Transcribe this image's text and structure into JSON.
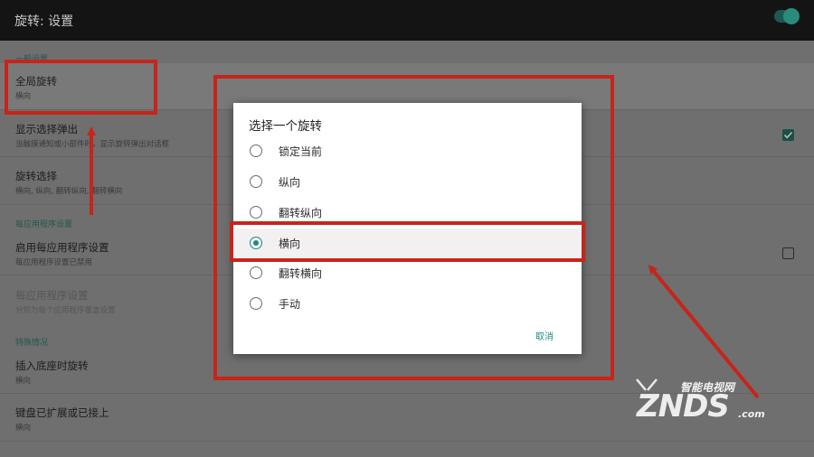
{
  "appbar": {
    "title": "旋转: 设置",
    "master_switch_on": true
  },
  "settings": {
    "general_header": "一般设置",
    "global_rotation": {
      "title": "全局旋转",
      "summary": "横向"
    },
    "show_popup": {
      "title": "显示选择弹出",
      "summary": "当触摸通知或小部件时，显示旋转弹出对话框",
      "checked": true
    },
    "rotation_selection": {
      "title": "旋转选择",
      "summary": "横向, 纵向, 翻转纵向, 翻转横向"
    },
    "per_app_header": "每应用程序设置",
    "enable_per_app": {
      "title": "启用每应用程序设置",
      "summary": "每应用程序设置已禁用",
      "checked": false
    },
    "per_app_settings": {
      "title": "每应用程序设置",
      "summary": "分别为每个应用程序覆盖设置"
    },
    "special_header": "特殊情况",
    "dock_rotation": {
      "title": "插入底座时旋转",
      "summary": "横向"
    },
    "keyboard_rotation": {
      "title": "键盘已扩展或已接上",
      "summary": "横向"
    }
  },
  "dialog": {
    "title": "选择一个旋转",
    "options": [
      {
        "label": "锁定当前",
        "selected": false
      },
      {
        "label": "纵向",
        "selected": false
      },
      {
        "label": "翻转纵向",
        "selected": false
      },
      {
        "label": "横向",
        "selected": true
      },
      {
        "label": "翻转横向",
        "selected": false
      },
      {
        "label": "手动",
        "selected": false
      }
    ],
    "cancel_label": "取消"
  },
  "watermark": {
    "top_text": "智能电视网",
    "brand": "ZNDS",
    "suffix": ".com"
  },
  "colors": {
    "accent": "#1a8c7d",
    "annotation_red": "#c7241a"
  }
}
